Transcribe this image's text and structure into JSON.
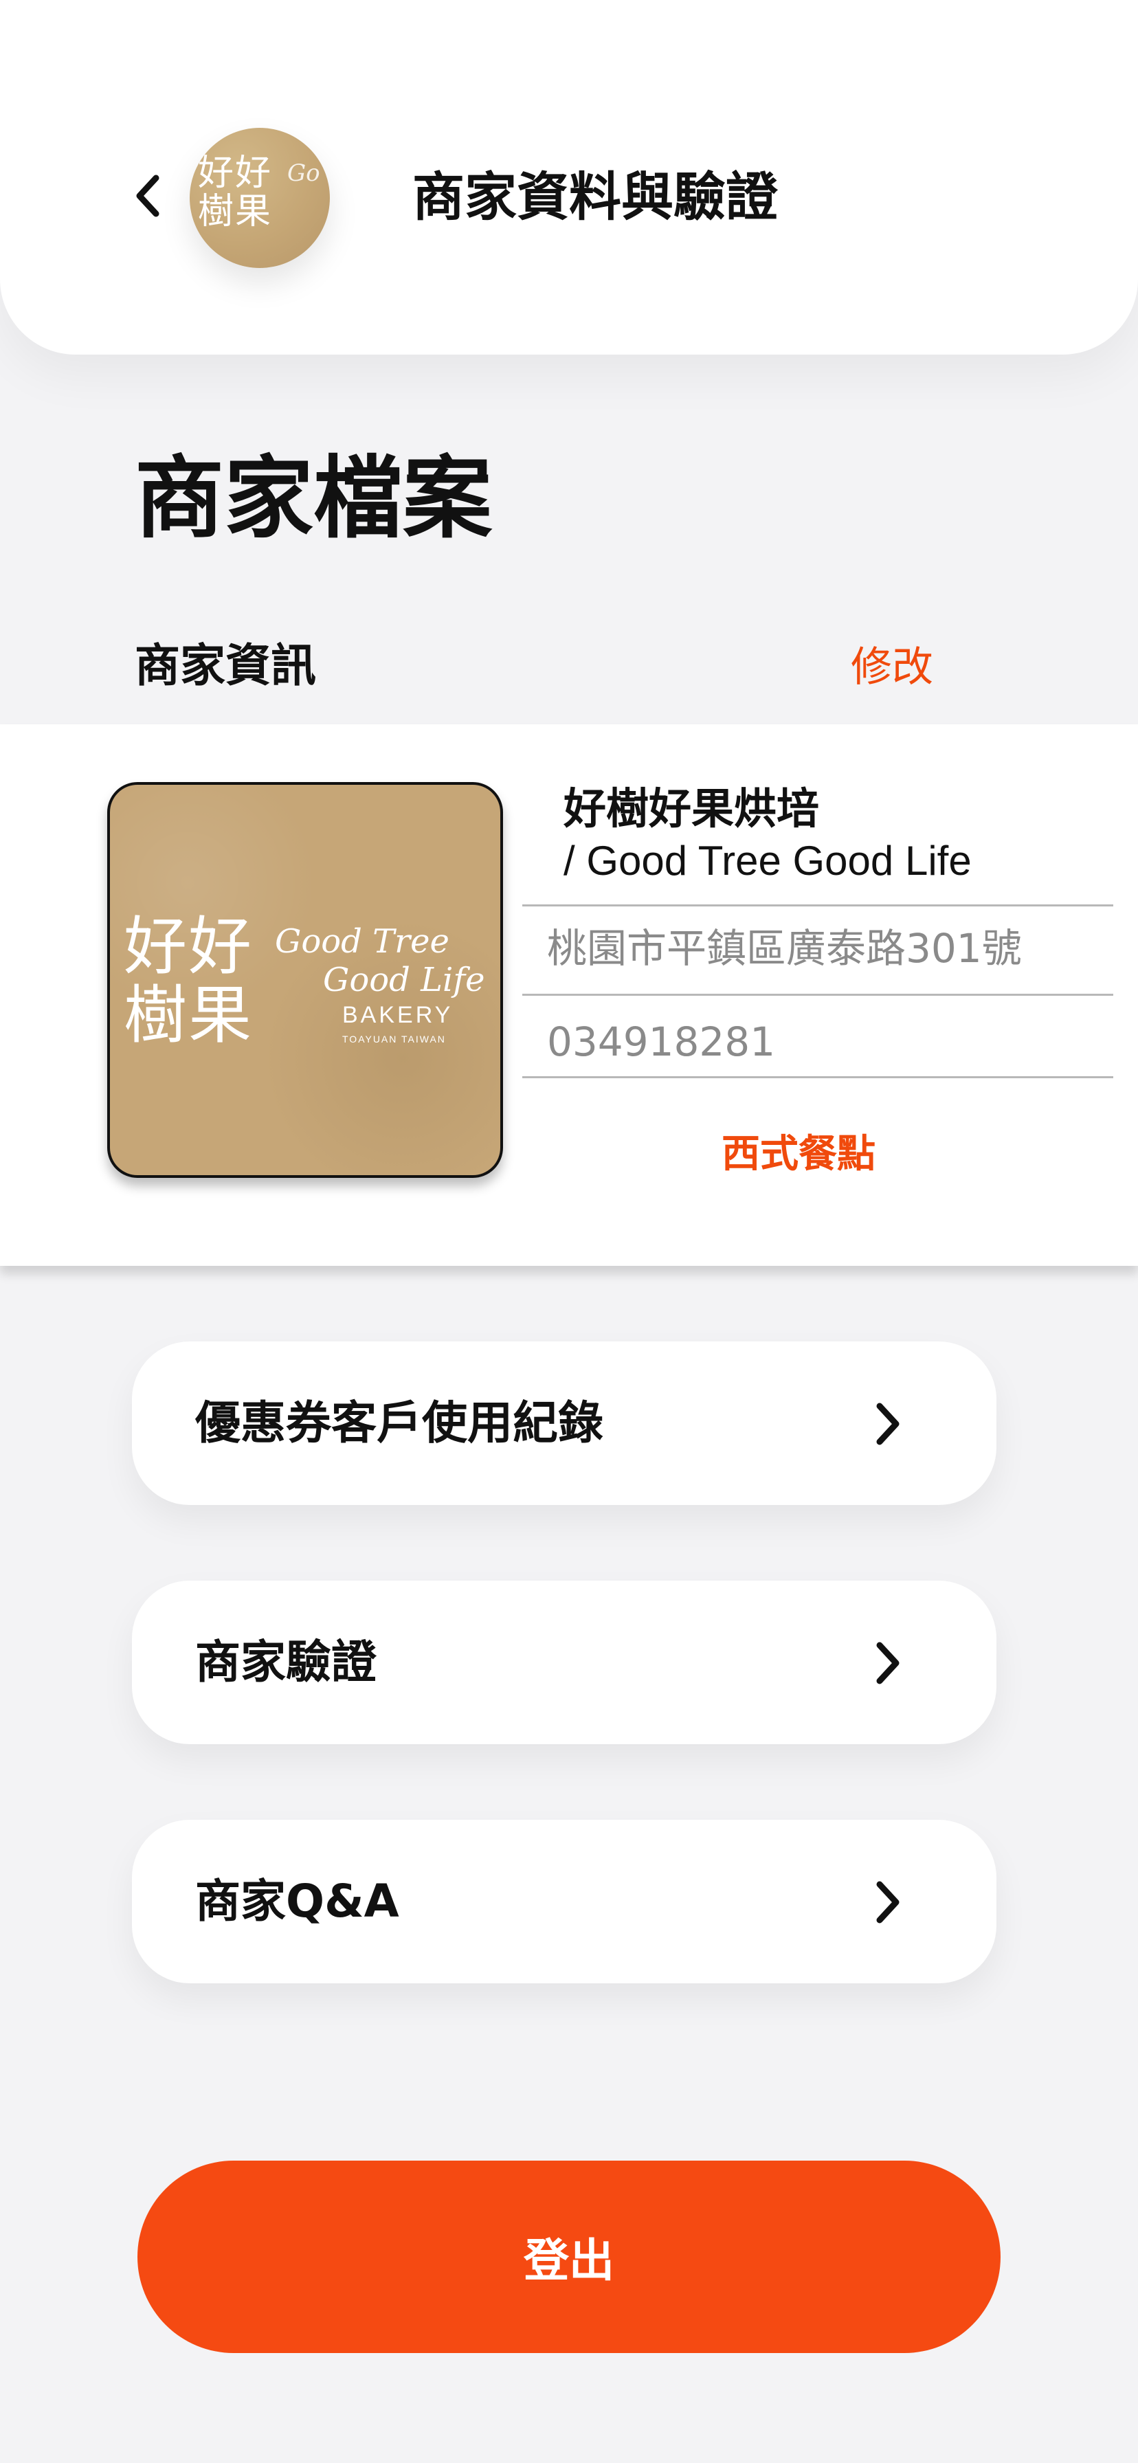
{
  "header": {
    "title": "商家資料與驗證",
    "avatar_text": "好好樹果",
    "avatar_script": "Go"
  },
  "page": {
    "title": "商家檔案"
  },
  "profile": {
    "section_label": "商家資訊",
    "edit_label": "修改",
    "photo": {
      "logo_cn": "好好樹果",
      "script_line1": "Good Tree",
      "script_line2": "Good Life",
      "bakery": "BAKERY",
      "subtitle": "TOAYUAN TAIWAN"
    },
    "store_name": "好樹好果烘培",
    "store_name_en": "/ Good Tree Good Life",
    "address": "桃園市平鎮區廣泰路301號",
    "phone": "034918281",
    "category": "西式餐點"
  },
  "menu": {
    "items": [
      {
        "label": "優惠券客戶使用紀錄"
      },
      {
        "label": "商家驗證"
      },
      {
        "label": "商家Q&A"
      }
    ]
  },
  "actions": {
    "logout_label": "登出"
  },
  "colors": {
    "accent": "#f04a0c",
    "logout_bg": "#f54a12",
    "background": "#f3f3f5"
  },
  "icons": {
    "back": "chevron-left-icon",
    "menu_arrow": "chevron-right-icon"
  }
}
